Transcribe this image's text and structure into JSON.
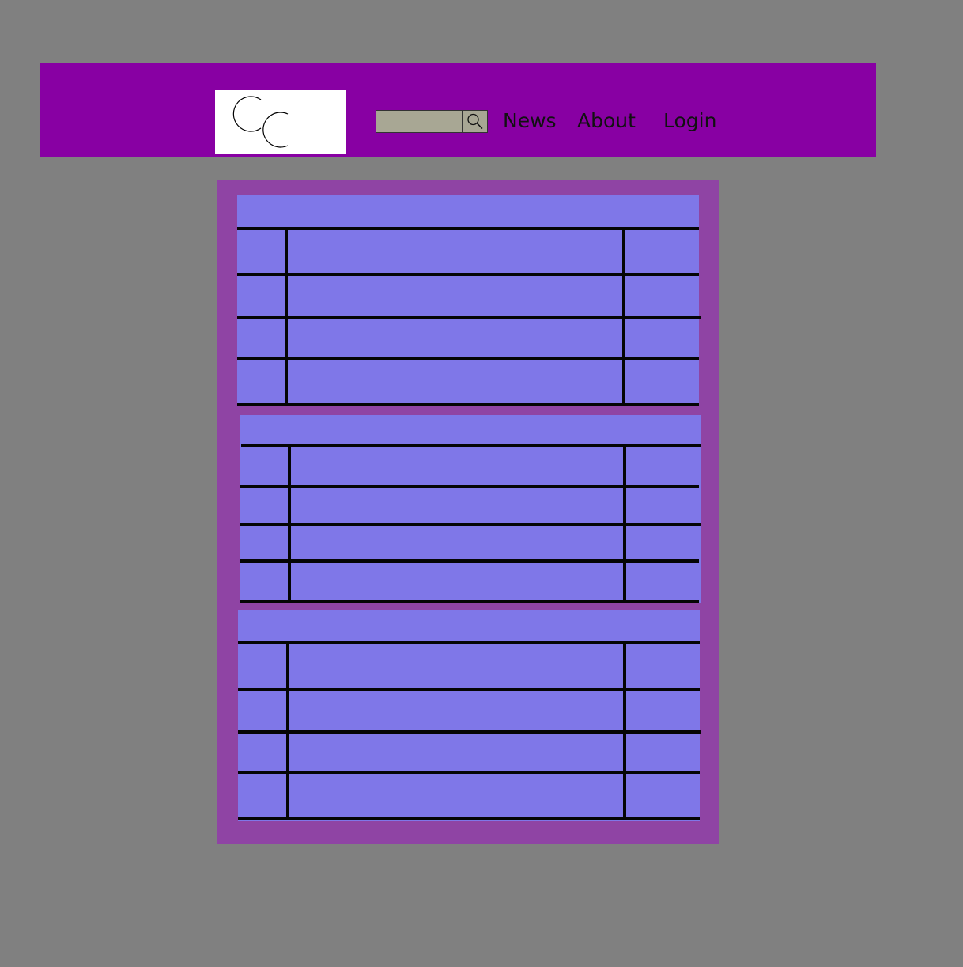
{
  "header": {
    "logo": {
      "alt": "CC logo"
    },
    "search": {
      "value": "",
      "placeholder": "",
      "button_icon": "magnifier-icon"
    },
    "nav": {
      "news": "News",
      "about": "About",
      "login": "Login"
    }
  },
  "main": {
    "panels": [
      {
        "title": "",
        "rows": [
          [
            "",
            "",
            ""
          ],
          [
            "",
            "",
            ""
          ],
          [
            "",
            "",
            ""
          ],
          [
            "",
            "",
            ""
          ]
        ]
      },
      {
        "title": "",
        "rows": [
          [
            "",
            "",
            ""
          ],
          [
            "",
            "",
            ""
          ],
          [
            "",
            "",
            ""
          ],
          [
            "",
            "",
            ""
          ]
        ]
      },
      {
        "title": "",
        "rows": [
          [
            "",
            "",
            ""
          ],
          [
            "",
            "",
            ""
          ],
          [
            "",
            "",
            ""
          ],
          [
            "",
            "",
            ""
          ]
        ]
      }
    ]
  },
  "colors": {
    "page_background": "#808080",
    "header_background": "#8800a3",
    "main_background": "#8f44a4",
    "panel_fill": "#7f77e8",
    "search_fill": "#a8a794",
    "grid_lines": "#050505"
  }
}
